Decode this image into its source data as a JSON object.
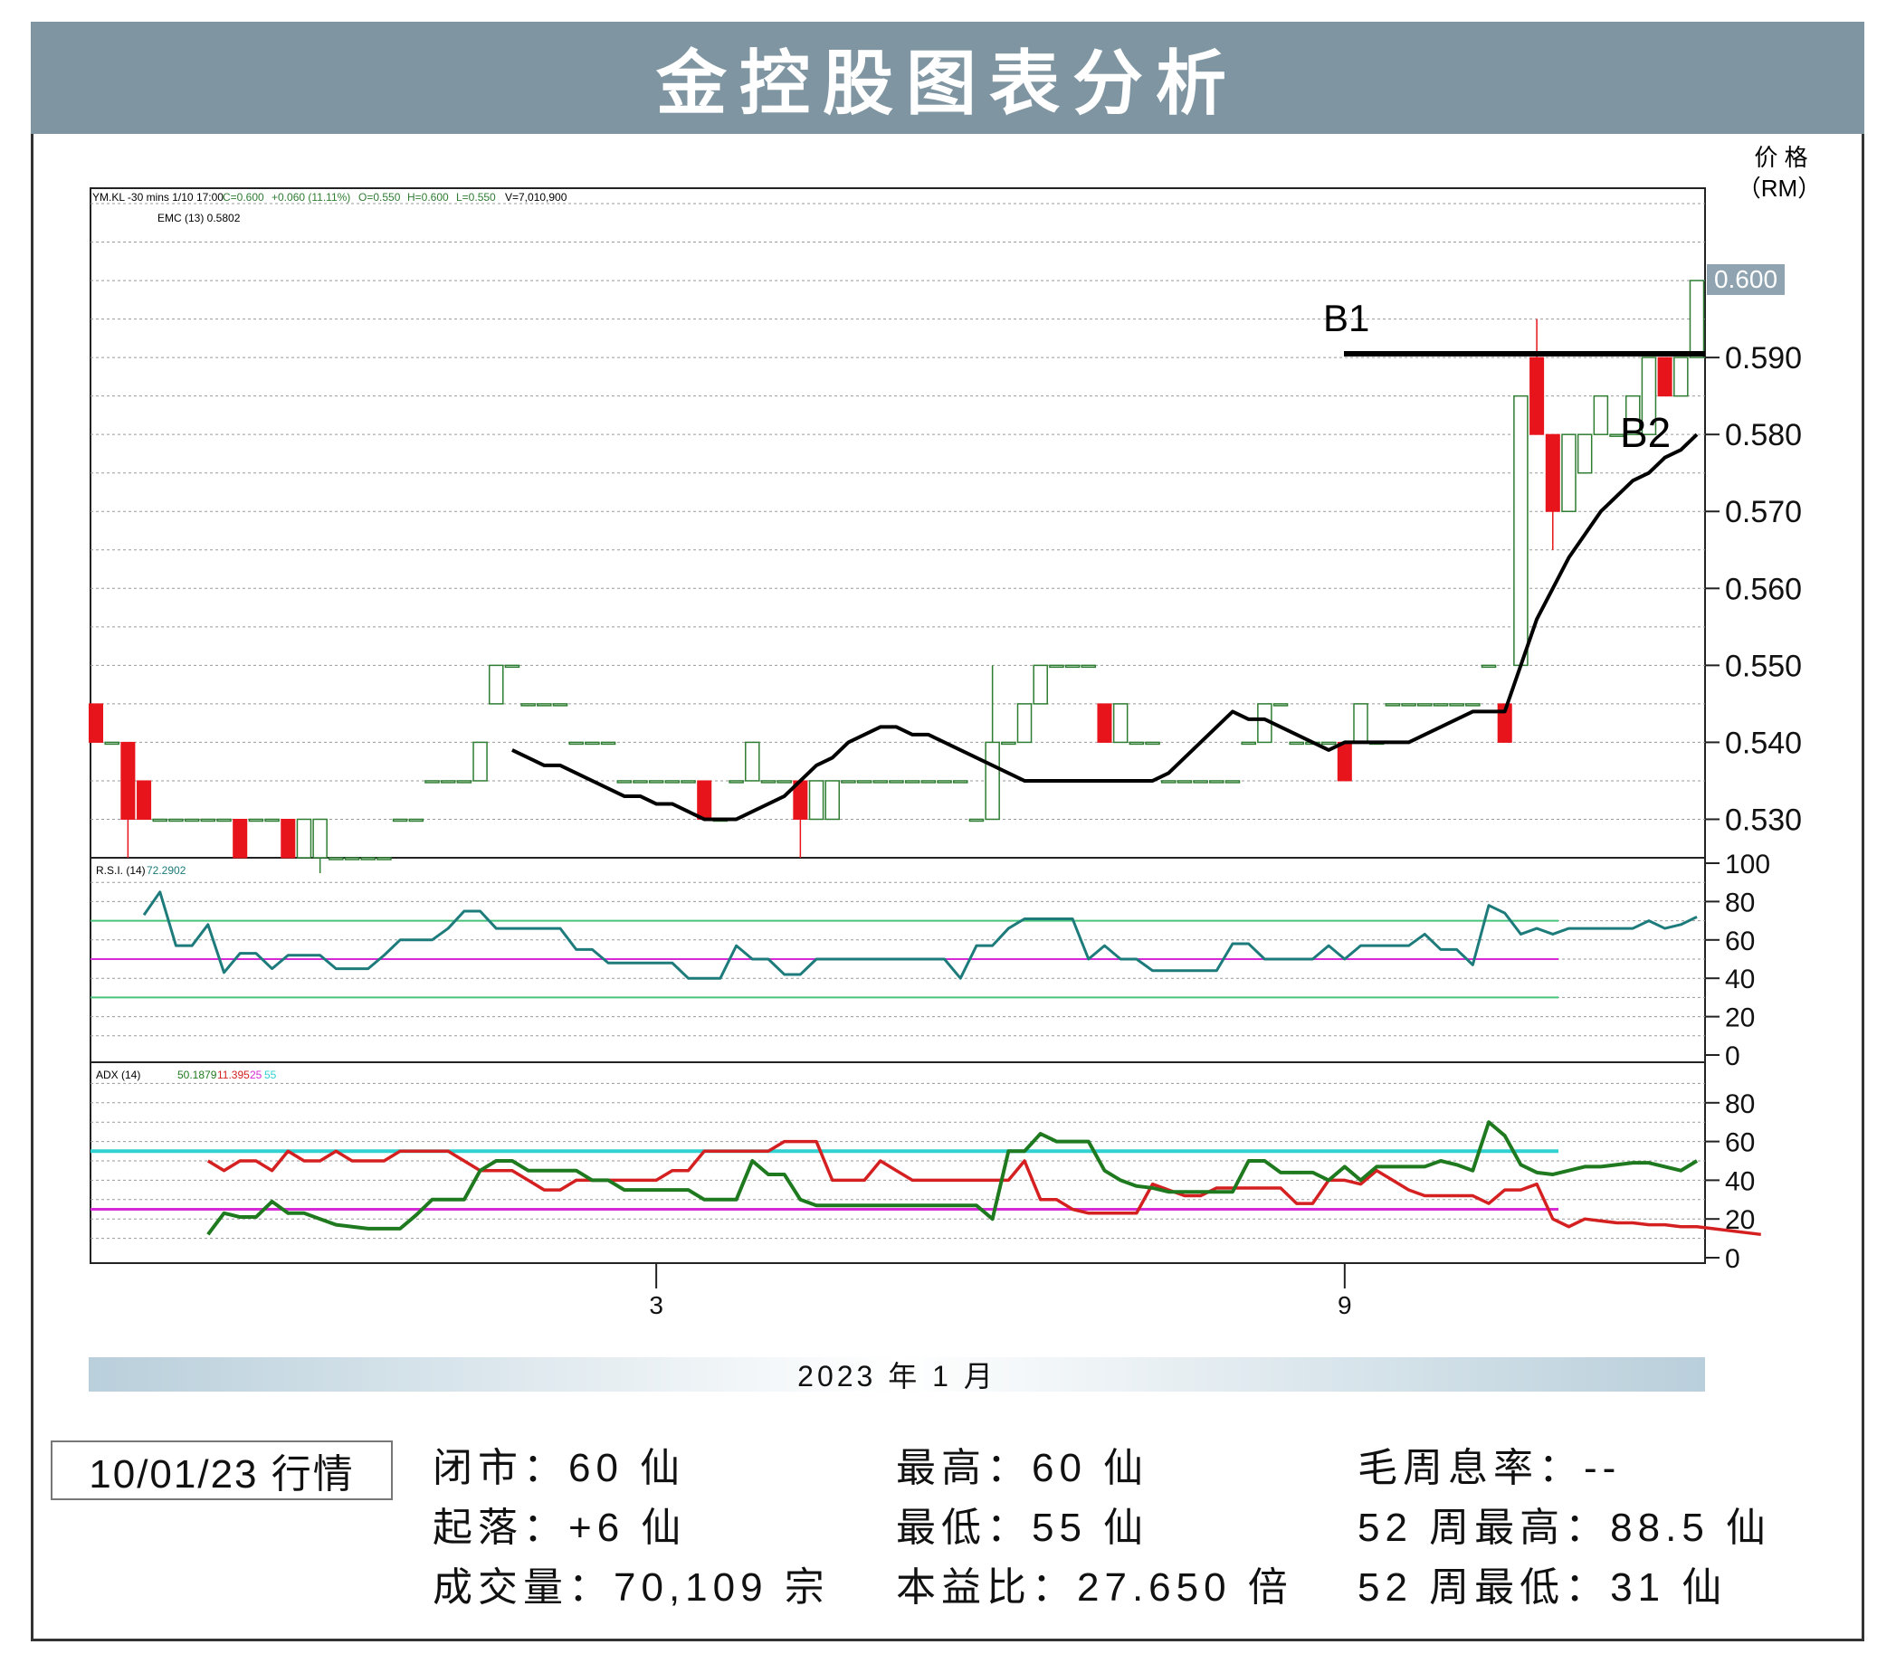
{
  "title": "金控股图表分析",
  "price_axis_label_line1": "价 格",
  "price_axis_label_line2": "（RM）",
  "header_text": {
    "symbol_line": "YM.KL -30 mins   1/10 17:00",
    "c": "C=0.600",
    "change": "+0.060 (11.11%)",
    "o": "O=0.550",
    "h": "H=0.600",
    "l": "L=0.550",
    "v": "V=7,010,900",
    "ema": "EMC (13) 0.5802",
    "rsi": "R.S.I. (14)",
    "rsi_val": "72.2902",
    "adx": "ADX (14)",
    "adx_v1": "50.1879",
    "adx_v2": "11.395",
    "adx_v3": "25",
    "adx_v4": "55"
  },
  "price_tag": "0.600",
  "annotations": {
    "b1": "B1",
    "b2": "B2"
  },
  "period_label": "2023 年 1 月",
  "date_label": "10/01/23 行情",
  "stats": {
    "close": "闭市：60 仙",
    "change": "起落：+6 仙",
    "volume": "成交量：70,109 宗",
    "high": "最高：60 仙",
    "low": "最低：55 仙",
    "pe": "本益比：27.650 倍",
    "yield": "毛周息率：--",
    "high52": "52 周最高：88.5 仙",
    "low52": "52 周最低：31 仙"
  },
  "colors": {
    "up": "#2e7d32",
    "down": "#e8141c",
    "ema": "#000000",
    "rsi": "#1e7b7b",
    "adx_plus": "#1f7a1f",
    "adx_minus": "#d42020",
    "cyan": "#31d1d1",
    "magenta": "#d62ad6",
    "title_bg": "#7f96a2"
  },
  "chart_data": [
    {
      "type": "candlestick",
      "ylabel": "价 格 （RM）",
      "ylim": [
        0.525,
        0.612
      ],
      "yticks": [
        "0.530",
        "0.540",
        "0.550",
        "0.560",
        "0.570",
        "0.580",
        "0.590"
      ],
      "xticks": [
        {
          "label": "3",
          "index": 35
        },
        {
          "label": "9",
          "index": 78
        }
      ],
      "candles": [
        [
          0.545,
          0.545,
          0.54,
          0.54
        ],
        [
          0.54,
          0.54,
          0.54,
          0.54
        ],
        [
          0.54,
          0.54,
          0.525,
          0.53
        ],
        [
          0.535,
          0.535,
          0.53,
          0.53
        ],
        [
          0.53,
          0.53,
          0.53,
          0.53
        ],
        [
          0.53,
          0.53,
          0.53,
          0.53
        ],
        [
          0.53,
          0.53,
          0.53,
          0.53
        ],
        [
          0.53,
          0.53,
          0.53,
          0.53
        ],
        [
          0.53,
          0.53,
          0.53,
          0.53
        ],
        [
          0.53,
          0.53,
          0.525,
          0.525
        ],
        [
          0.53,
          0.53,
          0.53,
          0.53
        ],
        [
          0.53,
          0.53,
          0.53,
          0.53
        ],
        [
          0.53,
          0.53,
          0.525,
          0.525
        ],
        [
          0.525,
          0.53,
          0.525,
          0.53
        ],
        [
          0.525,
          0.53,
          0.523,
          0.53
        ],
        [
          0.525,
          0.525,
          0.525,
          0.525
        ],
        [
          0.525,
          0.525,
          0.525,
          0.525
        ],
        [
          0.525,
          0.525,
          0.525,
          0.525
        ],
        [
          0.525,
          0.525,
          0.525,
          0.525
        ],
        [
          0.53,
          0.53,
          0.53,
          0.53
        ],
        [
          0.53,
          0.53,
          0.53,
          0.53
        ],
        [
          0.535,
          0.535,
          0.535,
          0.535
        ],
        [
          0.535,
          0.535,
          0.535,
          0.535
        ],
        [
          0.535,
          0.535,
          0.535,
          0.535
        ],
        [
          0.535,
          0.54,
          0.535,
          0.54
        ],
        [
          0.545,
          0.55,
          0.545,
          0.55
        ],
        [
          0.55,
          0.55,
          0.55,
          0.55
        ],
        [
          0.545,
          0.545,
          0.545,
          0.545
        ],
        [
          0.545,
          0.545,
          0.545,
          0.545
        ],
        [
          0.545,
          0.545,
          0.545,
          0.545
        ],
        [
          0.54,
          0.54,
          0.54,
          0.54
        ],
        [
          0.54,
          0.54,
          0.54,
          0.54
        ],
        [
          0.54,
          0.54,
          0.54,
          0.54
        ],
        [
          0.535,
          0.535,
          0.535,
          0.535
        ],
        [
          0.535,
          0.535,
          0.535,
          0.535
        ],
        [
          0.535,
          0.535,
          0.535,
          0.535
        ],
        [
          0.535,
          0.535,
          0.535,
          0.535
        ],
        [
          0.535,
          0.535,
          0.535,
          0.535
        ],
        [
          0.535,
          0.535,
          0.53,
          0.53
        ],
        [
          0.53,
          0.53,
          0.53,
          0.53
        ],
        [
          0.535,
          0.535,
          0.535,
          0.535
        ],
        [
          0.535,
          0.54,
          0.535,
          0.54
        ],
        [
          0.535,
          0.535,
          0.535,
          0.535
        ],
        [
          0.535,
          0.535,
          0.535,
          0.535
        ],
        [
          0.535,
          0.535,
          0.525,
          0.53
        ],
        [
          0.53,
          0.535,
          0.53,
          0.535
        ],
        [
          0.53,
          0.535,
          0.53,
          0.535
        ],
        [
          0.535,
          0.535,
          0.535,
          0.535
        ],
        [
          0.535,
          0.535,
          0.535,
          0.535
        ],
        [
          0.535,
          0.535,
          0.535,
          0.535
        ],
        [
          0.535,
          0.535,
          0.535,
          0.535
        ],
        [
          0.535,
          0.535,
          0.535,
          0.535
        ],
        [
          0.535,
          0.535,
          0.535,
          0.535
        ],
        [
          0.535,
          0.535,
          0.535,
          0.535
        ],
        [
          0.535,
          0.535,
          0.535,
          0.535
        ],
        [
          0.53,
          0.53,
          0.53,
          0.53
        ],
        [
          0.53,
          0.55,
          0.53,
          0.54
        ],
        [
          0.54,
          0.54,
          0.54,
          0.54
        ],
        [
          0.54,
          0.545,
          0.54,
          0.545
        ],
        [
          0.545,
          0.55,
          0.545,
          0.55
        ],
        [
          0.55,
          0.55,
          0.55,
          0.55
        ],
        [
          0.55,
          0.55,
          0.55,
          0.55
        ],
        [
          0.55,
          0.55,
          0.55,
          0.55
        ],
        [
          0.545,
          0.545,
          0.54,
          0.54
        ],
        [
          0.54,
          0.545,
          0.54,
          0.545
        ],
        [
          0.54,
          0.54,
          0.54,
          0.54
        ],
        [
          0.54,
          0.54,
          0.54,
          0.54
        ],
        [
          0.535,
          0.535,
          0.535,
          0.535
        ],
        [
          0.535,
          0.535,
          0.535,
          0.535
        ],
        [
          0.535,
          0.535,
          0.535,
          0.535
        ],
        [
          0.535,
          0.535,
          0.535,
          0.535
        ],
        [
          0.535,
          0.535,
          0.535,
          0.535
        ],
        [
          0.54,
          0.54,
          0.54,
          0.54
        ],
        [
          0.54,
          0.545,
          0.54,
          0.545
        ],
        [
          0.545,
          0.545,
          0.545,
          0.545
        ],
        [
          0.54,
          0.54,
          0.54,
          0.54
        ],
        [
          0.54,
          0.54,
          0.54,
          0.54
        ],
        [
          0.54,
          0.54,
          0.54,
          0.54
        ],
        [
          0.54,
          0.54,
          0.535,
          0.535
        ],
        [
          0.54,
          0.545,
          0.54,
          0.545
        ],
        [
          0.54,
          0.54,
          0.54,
          0.54
        ],
        [
          0.545,
          0.545,
          0.545,
          0.545
        ],
        [
          0.545,
          0.545,
          0.545,
          0.545
        ],
        [
          0.545,
          0.545,
          0.545,
          0.545
        ],
        [
          0.545,
          0.545,
          0.545,
          0.545
        ],
        [
          0.545,
          0.545,
          0.545,
          0.545
        ],
        [
          0.545,
          0.545,
          0.545,
          0.545
        ],
        [
          0.55,
          0.55,
          0.55,
          0.55
        ],
        [
          0.545,
          0.545,
          0.54,
          0.54
        ],
        [
          0.55,
          0.585,
          0.55,
          0.585
        ],
        [
          0.59,
          0.595,
          0.58,
          0.58
        ],
        [
          0.58,
          0.58,
          0.565,
          0.57
        ],
        [
          0.57,
          0.58,
          0.57,
          0.58
        ],
        [
          0.575,
          0.58,
          0.575,
          0.58
        ],
        [
          0.58,
          0.585,
          0.58,
          0.585
        ],
        [
          0.58,
          0.58,
          0.58,
          0.58
        ],
        [
          0.58,
          0.585,
          0.58,
          0.585
        ],
        [
          0.58,
          0.59,
          0.58,
          0.59
        ],
        [
          0.59,
          0.59,
          0.585,
          0.585
        ],
        [
          0.585,
          0.59,
          0.585,
          0.59
        ],
        [
          0.59,
          0.6,
          0.59,
          0.6
        ]
      ],
      "ema13": [
        0.539,
        0.538,
        0.537,
        0.537,
        0.536,
        0.535,
        0.534,
        0.533,
        0.533,
        0.532,
        0.532,
        0.531,
        0.53,
        0.53,
        0.53,
        0.531,
        0.532,
        0.533,
        0.535,
        0.537,
        0.538,
        0.54,
        0.541,
        0.542,
        0.542,
        0.541,
        0.541,
        0.54,
        0.539,
        0.538,
        0.537,
        0.536,
        0.535,
        0.535,
        0.535,
        0.535,
        0.535,
        0.535,
        0.535,
        0.535,
        0.535,
        0.536,
        0.538,
        0.54,
        0.542,
        0.544,
        0.543,
        0.543,
        0.542,
        0.541,
        0.54,
        0.539,
        0.54,
        0.54,
        0.54,
        0.54,
        0.54,
        0.541,
        0.542,
        0.543,
        0.544,
        0.544,
        0.544,
        0.55,
        0.556,
        0.56,
        0.564,
        0.567,
        0.57,
        0.572,
        0.574,
        0.575,
        0.577,
        0.578,
        0.58
      ]
    },
    {
      "type": "line",
      "name_label": "R.S.I. (14)",
      "ylim": [
        0,
        100
      ],
      "yticks": [
        "100",
        "80",
        "60",
        "40",
        "20",
        "0"
      ],
      "reference_lines": [
        70,
        50,
        30
      ],
      "values": [
        73,
        85,
        57,
        57,
        68,
        43,
        53,
        53,
        45,
        52,
        52,
        52,
        45,
        45,
        45,
        52,
        60,
        60,
        60,
        66,
        75,
        75,
        66,
        66,
        66,
        66,
        66,
        55,
        55,
        48,
        48,
        48,
        48,
        48,
        40,
        40,
        40,
        57,
        50,
        50,
        42,
        42,
        50,
        50,
        50,
        50,
        50,
        50,
        50,
        50,
        50,
        40,
        57,
        57,
        66,
        71,
        71,
        71,
        71,
        50,
        57,
        50,
        50,
        44,
        44,
        44,
        44,
        44,
        58,
        58,
        50,
        50,
        50,
        50,
        57,
        50,
        57,
        57,
        57,
        57,
        63,
        55,
        55,
        47,
        78,
        74,
        63,
        66,
        63,
        66,
        66,
        66,
        66,
        66,
        70,
        66,
        68,
        72
      ]
    },
    {
      "type": "line",
      "name_label": "ADX (14)",
      "ylim": [
        0,
        100
      ],
      "yticks": [
        "80",
        "60",
        "40",
        "20",
        "0"
      ],
      "reference_lines": [
        55,
        25
      ],
      "series": [
        {
          "values": [
            12,
            23,
            21,
            21,
            29,
            23,
            23,
            20,
            17,
            16,
            15,
            15,
            15,
            22,
            30,
            30,
            30,
            45,
            50,
            50,
            45,
            45,
            45,
            45,
            40,
            40,
            35,
            35,
            35,
            35,
            35,
            30,
            30,
            30,
            50,
            43,
            43,
            30,
            27,
            27,
            27,
            27,
            27,
            27,
            27,
            27,
            27,
            27,
            27,
            20,
            55,
            55,
            64,
            60,
            60,
            60,
            45,
            40,
            37,
            36,
            34,
            34,
            34,
            34,
            34,
            50,
            50,
            44,
            44,
            44,
            40,
            47,
            40,
            47,
            47,
            47,
            47,
            50,
            48,
            45,
            70,
            63,
            48,
            44,
            43,
            45,
            47,
            47,
            48,
            49,
            49,
            47,
            45,
            50
          ]
        },
        {
          "values": [
            50,
            45,
            50,
            50,
            45,
            55,
            50,
            50,
            55,
            50,
            50,
            50,
            55,
            55,
            55,
            55,
            50,
            45,
            45,
            45,
            40,
            35,
            35,
            40,
            40,
            40,
            40,
            40,
            40,
            45,
            45,
            55,
            55,
            55,
            55,
            55,
            60,
            60,
            60,
            40,
            40,
            40,
            50,
            45,
            40,
            40,
            40,
            40,
            40,
            40,
            40,
            50,
            30,
            30,
            25,
            23,
            23,
            23,
            23,
            38,
            35,
            32,
            32,
            36,
            36,
            36,
            36,
            36,
            28,
            28,
            40,
            40,
            38,
            45,
            40,
            35,
            32,
            32,
            32,
            32,
            28,
            35,
            35,
            38,
            20,
            16,
            20,
            19,
            18,
            18,
            17,
            17,
            16,
            16,
            15,
            14,
            13,
            12
          ]
        }
      ]
    }
  ]
}
